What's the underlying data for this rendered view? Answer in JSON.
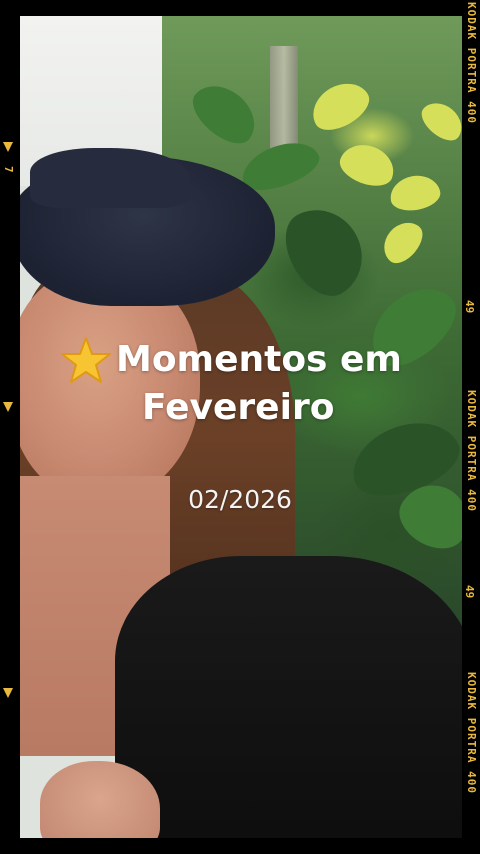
{
  "overlay": {
    "star_icon": "star-emoji",
    "title_line1": "Momentos em",
    "title_line2": "Fevereiro",
    "date": "02/2026"
  },
  "film_frame": {
    "brand_marks": [
      "KODAK PORTRA 400",
      "KODAK PORTRA 400",
      "KODAK PORTRA 400"
    ],
    "frame_numbers_right": [
      "49",
      "49"
    ],
    "frame_number_left": "7",
    "accent_color": "#e9b93f"
  }
}
